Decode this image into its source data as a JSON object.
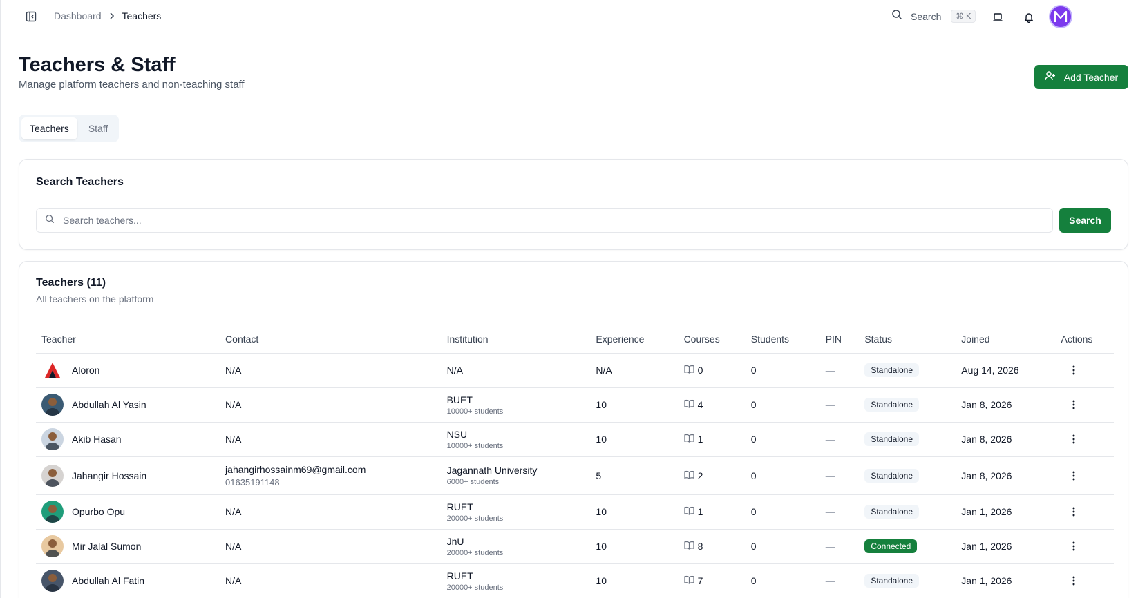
{
  "breadcrumb": {
    "root": "Dashboard",
    "current": "Teachers"
  },
  "topbar": {
    "search_label": "Search",
    "shortcut": "⌘ K",
    "avatar_initial": "M",
    "avatar_color": "#7c3aed"
  },
  "header": {
    "title": "Teachers & Staff",
    "subtitle": "Manage platform teachers and non-teaching staff",
    "add_button": "Add Teacher"
  },
  "tabs": [
    {
      "label": "Teachers",
      "active": true
    },
    {
      "label": "Staff",
      "active": false
    }
  ],
  "search_card": {
    "title": "Search Teachers",
    "placeholder": "Search teachers...",
    "button": "Search"
  },
  "table_card": {
    "title": "Teachers (11)",
    "description": "All teachers on the platform",
    "columns": [
      "Teacher",
      "Contact",
      "Institution",
      "Experience",
      "Courses",
      "Students",
      "PIN",
      "Status",
      "Joined",
      "Actions"
    ],
    "rows": [
      {
        "name": "Aloron",
        "contact": "N/A",
        "phone": "",
        "institution": "N/A",
        "institution_size": "",
        "experience": "N/A",
        "courses": "0",
        "students": "0",
        "pin": "—",
        "status": "Standalone",
        "joined": "Aug 14, 2026",
        "avatar": "logo"
      },
      {
        "name": "Abdullah Al Yasin",
        "contact": "N/A",
        "phone": "",
        "institution": "BUET",
        "institution_size": "10000+ students",
        "experience": "10",
        "courses": "4",
        "students": "0",
        "pin": "—",
        "status": "Standalone",
        "joined": "Jan 8, 2026",
        "avatar": "#3b5b74"
      },
      {
        "name": "Akib Hasan",
        "contact": "N/A",
        "phone": "",
        "institution": "NSU",
        "institution_size": "10000+ students",
        "experience": "10",
        "courses": "1",
        "students": "0",
        "pin": "—",
        "status": "Standalone",
        "joined": "Jan 8, 2026",
        "avatar": "#cbd5e1"
      },
      {
        "name": "Jahangir Hossain",
        "contact": "jahangirhossainm69@gmail.com",
        "phone": "01635191148",
        "institution": "Jagannath University",
        "institution_size": "6000+ students",
        "experience": "5",
        "courses": "2",
        "students": "0",
        "pin": "—",
        "status": "Standalone",
        "joined": "Jan 8, 2026",
        "avatar": "#d6d3d1"
      },
      {
        "name": "Opurbo Opu",
        "contact": "N/A",
        "phone": "",
        "institution": "RUET",
        "institution_size": "20000+ students",
        "experience": "10",
        "courses": "1",
        "students": "0",
        "pin": "—",
        "status": "Standalone",
        "joined": "Jan 1, 2026",
        "avatar": "#1f9d7a"
      },
      {
        "name": "Mir Jalal Sumon",
        "contact": "N/A",
        "phone": "",
        "institution": "JnU",
        "institution_size": "20000+ students",
        "experience": "10",
        "courses": "8",
        "students": "0",
        "pin": "—",
        "status": "Connected",
        "joined": "Jan 1, 2026",
        "avatar": "#e8c9a0"
      },
      {
        "name": "Abdullah Al Fatin",
        "contact": "N/A",
        "phone": "",
        "institution": "RUET",
        "institution_size": "20000+ students",
        "experience": "10",
        "courses": "7",
        "students": "0",
        "pin": "—",
        "status": "Standalone",
        "joined": "Jan 1, 2026",
        "avatar": "#475569"
      }
    ]
  },
  "colors": {
    "primary": "#15803d",
    "border": "#e5e7eb",
    "muted": "#6b7280"
  }
}
